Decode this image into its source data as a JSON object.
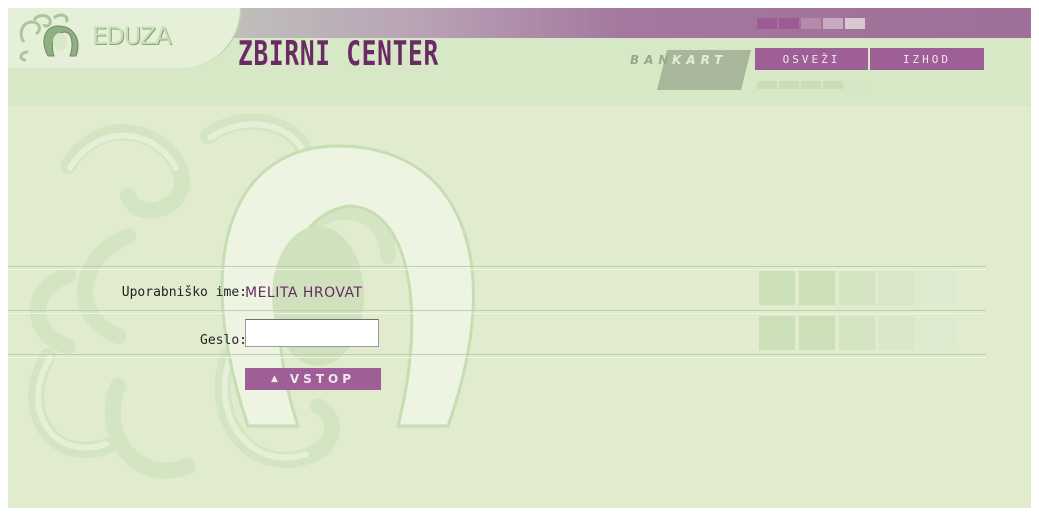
{
  "header": {
    "logo_text": "EDUZA",
    "title": "ZBIRNI CENTER",
    "bankart_left": "BAN",
    "bankart_right": "KART",
    "nav": {
      "refresh_label": "OSVEŽI",
      "logout_label": "IZHOD"
    }
  },
  "login_form": {
    "username_label": "Uporabniško ime:",
    "username_value": "MELITA HROVAT",
    "password_label": "Geslo:",
    "password_value": "",
    "submit_label": "VSTOP",
    "submit_icon": "up-arrow-icon"
  },
  "colors": {
    "background": "#e0eccd",
    "accent_purple": "#9e5e96",
    "title_purple": "#6a2a63"
  }
}
